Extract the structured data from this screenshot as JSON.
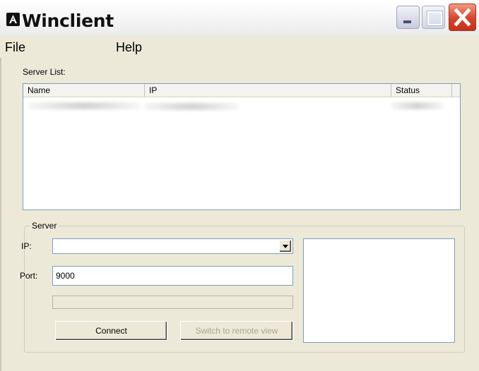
{
  "window": {
    "title": "Winclient",
    "icon": "app-logo-icon",
    "controls": {
      "minimize": "minimize-icon",
      "maximize": "maximize-icon",
      "close": "close-icon"
    }
  },
  "menu": {
    "file": "File",
    "help": "Help"
  },
  "server_list": {
    "label": "Server List:",
    "columns": [
      "Name",
      "IP",
      "Status"
    ],
    "rows_visible": 1
  },
  "server_group": {
    "title": "Server",
    "ip_label": "IP:",
    "ip_value": "",
    "port_label": "Port:",
    "port_value": "9000",
    "progress_percent": 0,
    "connect_label": "Connect",
    "remote_label": "Switch to remote view"
  },
  "colors": {
    "dialog_bg": "#ece9d8",
    "border_blue": "#7f9db9",
    "close_red": "#d6432a"
  }
}
